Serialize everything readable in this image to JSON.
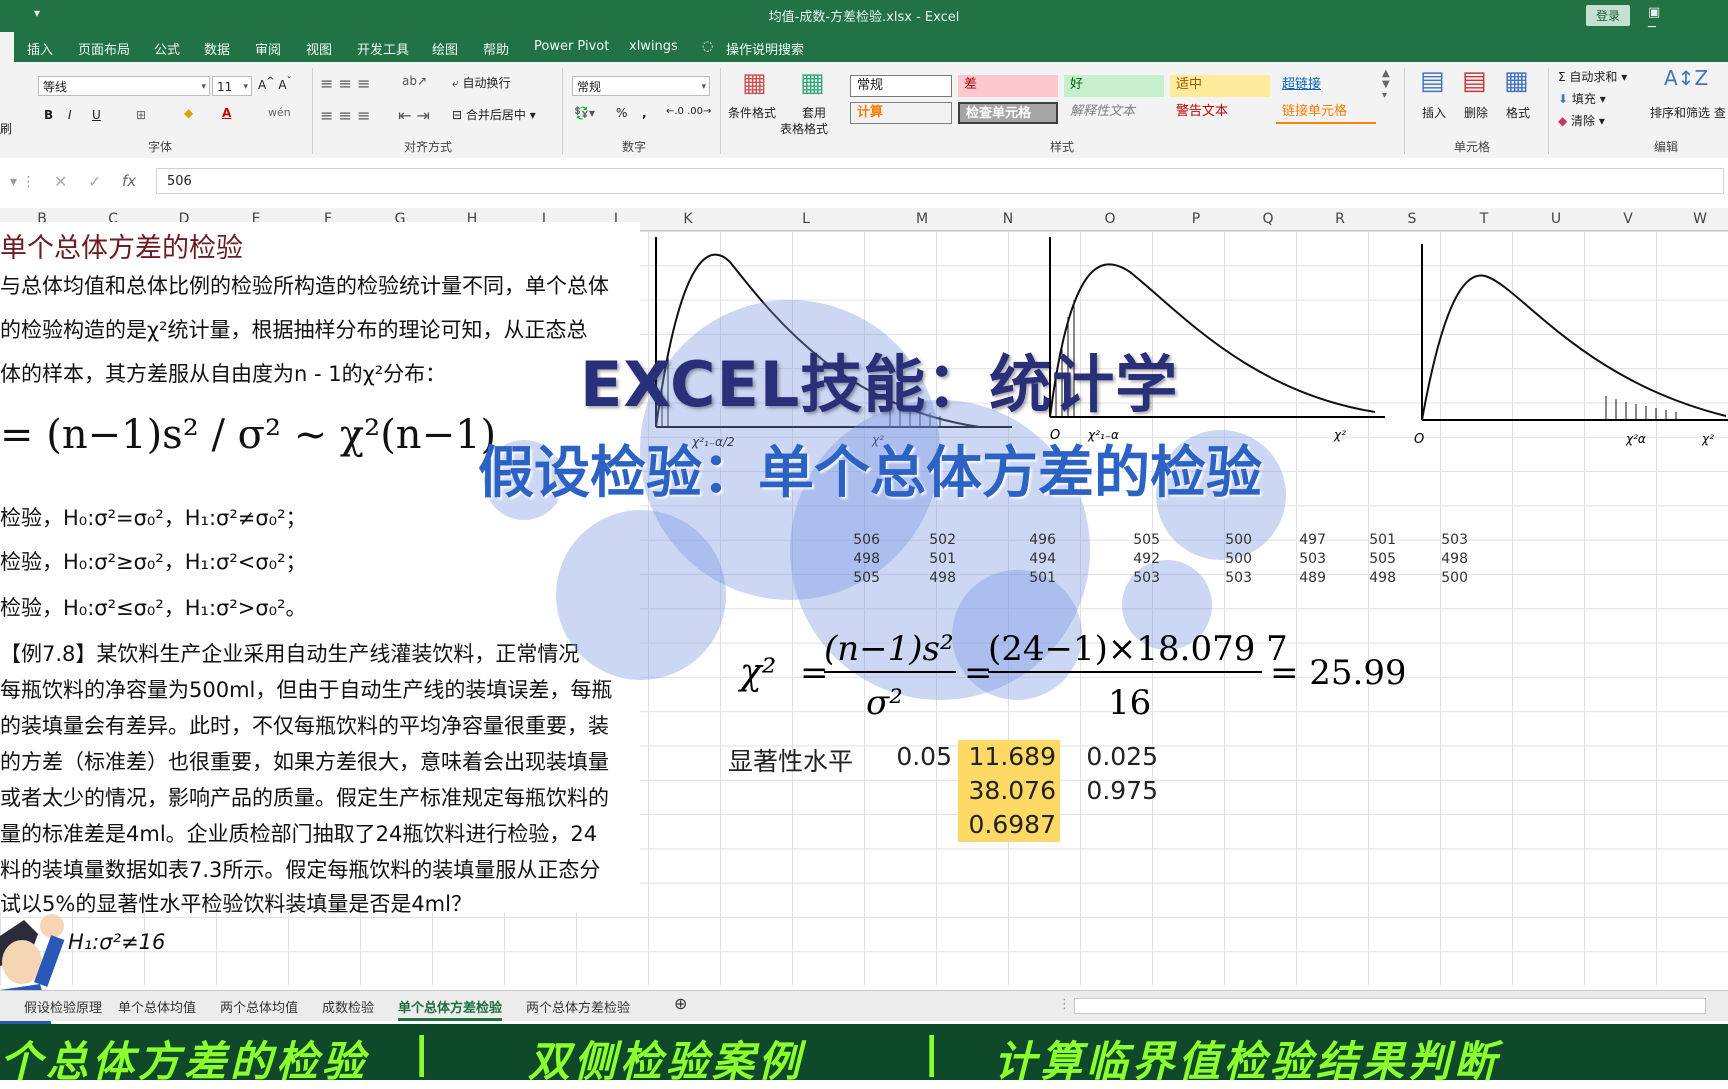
{
  "window": {
    "title": "均值-成数-方差检验.xlsx  -  Excel",
    "login": "登录",
    "qat_icon": "customize-qat-icon"
  },
  "ribbon_tabs": [
    "插入",
    "页面布局",
    "公式",
    "数据",
    "审阅",
    "视图",
    "开发工具",
    "绘图",
    "帮助",
    "Power Pivot",
    "xlwings",
    "操作说明搜索"
  ],
  "ribbon": {
    "font_name": "等线",
    "font_size": "11",
    "font_group": "字体",
    "align_group": "对齐方式",
    "wrap_text": "自动换行",
    "merge_center": "合并后居中",
    "number_format": "常规",
    "number_group": "数字",
    "conditional_format": "条件格式",
    "table_format_1": "套用",
    "table_format_2": "表格格式",
    "styles_group": "样式",
    "styles": {
      "normal": "常规",
      "bad": "差",
      "good": "好",
      "neutral": "适中",
      "hyperlink": "超链接",
      "calc": "计算",
      "check_cell": "检查单元格",
      "explanatory": "解释性文本",
      "warning": "警告文本",
      "linked": "链接单元格"
    },
    "insert": "插入",
    "delete": "删除",
    "format": "格式",
    "cells_group": "单元格",
    "autosum": "自动求和",
    "fill": "填充",
    "clear": "清除",
    "sort_filter": "排序和筛选",
    "find": "查",
    "editing_group": "编辑",
    "clipboard_fragment": "刷"
  },
  "formula_bar": {
    "value": "506",
    "fx": "fx"
  },
  "columns": [
    "B",
    "C",
    "D",
    "E",
    "F",
    "G",
    "H",
    "I",
    "J",
    "K",
    "L",
    "M",
    "N",
    "O",
    "P",
    "Q",
    "R",
    "S",
    "T",
    "U",
    "V",
    "W"
  ],
  "left_text": {
    "title": "单个总体方差的检验",
    "line1": "与总体均值和总体比例的检验所构造的检验统计量不同，单个总体",
    "line2": "的检验构造的是χ²统计量，根据抽样分布的理论可知，从正态总",
    "line3": "体的样本，其方差服从自由度为n - 1的χ²分布：",
    "formula": "= (n−1)s² / σ² ~ χ²(n−1)",
    "h_two": "检验，H₀:σ²=σ₀²，H₁:σ²≠σ₀²；",
    "h_left": "检验，H₀:σ²≥σ₀²，H₁:σ²<σ₀²；",
    "h_right": "检验，H₀:σ²≤σ₀²，H₁:σ²>σ₀²。",
    "ex1": "【例7.8】某饮料生产企业采用自动生产线灌装饮料，正常情况",
    "ex2": "每瓶饮料的净容量为500ml，但由于自动生产线的装填误差，每瓶",
    "ex3": "的装填量会有差异。此时，不仅每瓶饮料的平均净容量很重要，装",
    "ex4": "的方差（标准差）也很重要，如果方差很大，意味着会出现装填量",
    "ex5": "或者太少的情况，影响产品的质量。假定生产标准规定每瓶饮料的",
    "ex6": "量的标准差是4ml。企业质检部门抽取了24瓶饮料进行检验，24",
    "ex7": "料的装填量数据如表7.3所示。假定每瓶饮料的装填量服从正态分",
    "ex8": "试以5%的显著性水平检验饮料装填量是否是4ml？",
    "hyp": "H₁:σ²≠16"
  },
  "overlay": {
    "title1": "EXCEL技能：统计学",
    "title2": "假设检验：单个总体方差的检验"
  },
  "charts": {
    "chart1_labels": [
      "χ²₁₋α/2",
      "χ²"
    ],
    "chart2_labels": [
      "O",
      "χ²₁₋α",
      "χ²"
    ],
    "chart3_labels": [
      "O",
      "χ²α",
      "χ²"
    ]
  },
  "data_rows": [
    [
      "506",
      "502",
      "496",
      "505",
      "500",
      "497",
      "501",
      "503"
    ],
    [
      "498",
      "501",
      "494",
      "492",
      "500",
      "503",
      "505",
      "498"
    ],
    [
      "505",
      "498",
      "501",
      "503",
      "503",
      "489",
      "498",
      "500"
    ]
  ],
  "chi_formula": {
    "lhs": "χ²",
    "frac1_num": "(n−1)s²",
    "frac1_den": "σ²",
    "frac2_num": "(24−1)×18.079 7",
    "frac2_den": "16",
    "result": "= 25.99"
  },
  "significance": {
    "label": "显著性水平",
    "alpha": "0.05",
    "crit_low": "11.689",
    "crit_high": "38.076",
    "p_value": "0.6987",
    "half_alpha": "0.025",
    "one_minus_half": "0.975"
  },
  "sheet_tabs": [
    "假设检验原理",
    "单个总体均值",
    "两个总体均值",
    "成数检验",
    "单个总体方差检验",
    "两个总体方差检验"
  ],
  "active_sheet_index": 4,
  "banner": {
    "part1": "个总体方差的检验",
    "part2": "双侧检验案例",
    "part3": "计算临界值检验结果判断",
    "sep": "|"
  },
  "colors": {
    "excel_green": "#217346",
    "highlight_yellow": "#ffd966",
    "banner_green": "#8cff2e",
    "title_red": "#6b1d24"
  }
}
